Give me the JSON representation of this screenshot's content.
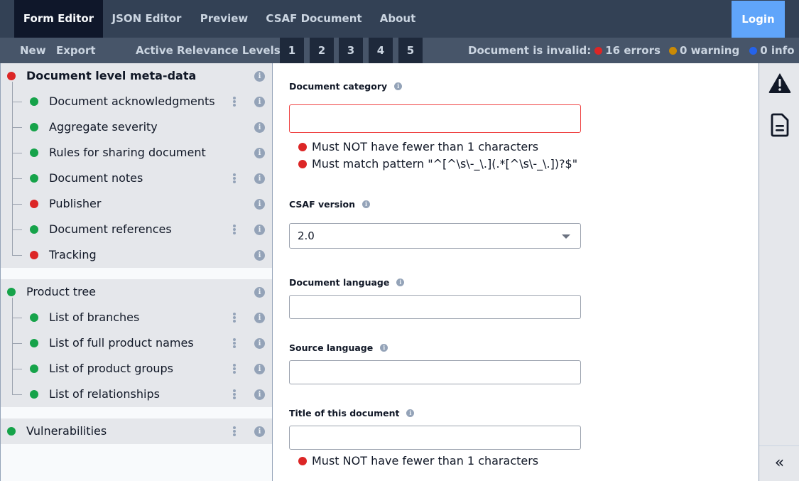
{
  "nav": {
    "tabs": [
      {
        "label": "Form Editor",
        "active": true
      },
      {
        "label": "JSON Editor",
        "active": false
      },
      {
        "label": "Preview",
        "active": false
      },
      {
        "label": "CSAF Document",
        "active": false
      },
      {
        "label": "About",
        "active": false
      }
    ],
    "login_label": "Login"
  },
  "toolbar": {
    "new_label": "New",
    "export_label": "Export",
    "relevance_label": "Active Relevance Levels:",
    "levels": [
      "1",
      "2",
      "3",
      "4",
      "5"
    ],
    "status": {
      "label": "Document is invalid:",
      "errors": "16 errors",
      "warnings": "0 warning",
      "info": "0 info"
    }
  },
  "colors": {
    "error": "#dc2626",
    "warning": "#ca8a04",
    "info": "#2563eb",
    "valid": "#16a34a",
    "accent": "#60a5fa"
  },
  "sidebar": {
    "sections": [
      {
        "label": "Document level meta-data",
        "status": "error",
        "bold": true,
        "children": [
          {
            "label": "Document acknowledgments",
            "status": "valid",
            "menu": true
          },
          {
            "label": "Aggregate severity",
            "status": "valid",
            "menu": false
          },
          {
            "label": "Rules for sharing document",
            "status": "valid",
            "menu": false
          },
          {
            "label": "Document notes",
            "status": "valid",
            "menu": true
          },
          {
            "label": "Publisher",
            "status": "error",
            "menu": false
          },
          {
            "label": "Document references",
            "status": "valid",
            "menu": true
          },
          {
            "label": "Tracking",
            "status": "error",
            "menu": false
          }
        ]
      },
      {
        "label": "Product tree",
        "status": "valid",
        "bold": false,
        "children": [
          {
            "label": "List of branches",
            "status": "valid",
            "menu": true
          },
          {
            "label": "List of full product names",
            "status": "valid",
            "menu": true
          },
          {
            "label": "List of product groups",
            "status": "valid",
            "menu": true
          },
          {
            "label": "List of relationships",
            "status": "valid",
            "menu": true
          }
        ]
      },
      {
        "label": "Vulnerabilities",
        "status": "valid",
        "bold": false,
        "menu": true,
        "children": []
      }
    ]
  },
  "form": {
    "category": {
      "label": "Document category",
      "value": "",
      "errors": [
        "Must NOT have fewer than 1 characters",
        "Must match pattern \"^[^\\s\\-_\\.](.*[^\\s\\-_\\.])?$\""
      ]
    },
    "csaf_version": {
      "label": "CSAF version",
      "value": "2.0"
    },
    "lang": {
      "label": "Document language",
      "value": ""
    },
    "source_lang": {
      "label": "Source language",
      "value": ""
    },
    "title": {
      "label": "Title of this document",
      "value": "",
      "errors": [
        "Must NOT have fewer than 1 characters"
      ]
    }
  },
  "right_panel": {
    "icons": [
      "warning-icon",
      "document-icon"
    ],
    "collapse_glyph": "«"
  },
  "info_glyph": "i"
}
